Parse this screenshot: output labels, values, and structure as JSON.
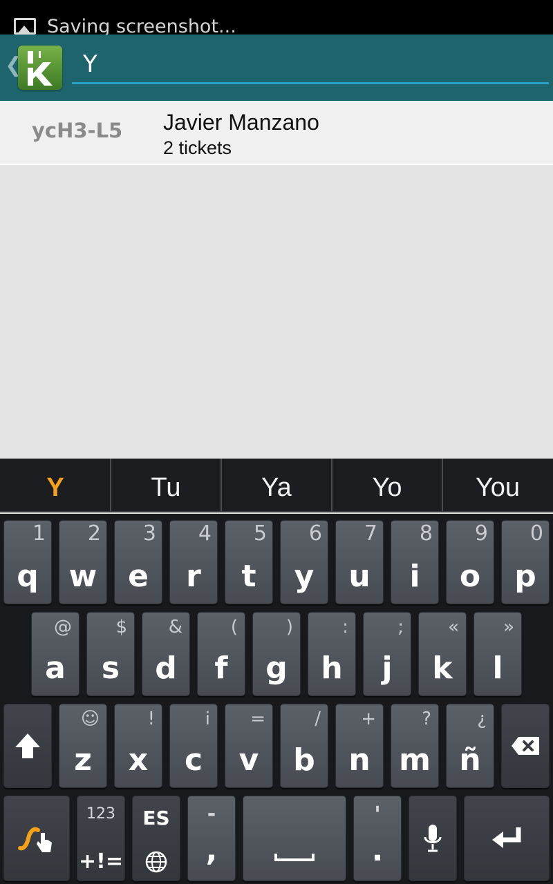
{
  "status_bar": {
    "notification_text": "Saving screenshot..."
  },
  "action_bar": {
    "search_value": "Y",
    "back_icon": "chevron-left-icon",
    "logo_icon": "k-app-logo"
  },
  "results": [
    {
      "code": "ycH3-L5",
      "name": "Javier Manzano",
      "detail": "2 tickets"
    }
  ],
  "suggestions": [
    "Y",
    "Tu",
    "Ya",
    "Yo",
    "You"
  ],
  "keyboard": {
    "row1": [
      {
        "main": "q",
        "sub": "1"
      },
      {
        "main": "w",
        "sub": "2"
      },
      {
        "main": "e",
        "sub": "3"
      },
      {
        "main": "r",
        "sub": "4"
      },
      {
        "main": "t",
        "sub": "5"
      },
      {
        "main": "y",
        "sub": "6"
      },
      {
        "main": "u",
        "sub": "7"
      },
      {
        "main": "i",
        "sub": "8"
      },
      {
        "main": "o",
        "sub": "9"
      },
      {
        "main": "p",
        "sub": "0"
      }
    ],
    "row2": [
      {
        "main": "a",
        "sub": "@"
      },
      {
        "main": "s",
        "sub": "$"
      },
      {
        "main": "d",
        "sub": "&"
      },
      {
        "main": "f",
        "sub": "("
      },
      {
        "main": "g",
        "sub": ")"
      },
      {
        "main": "h",
        "sub": ":"
      },
      {
        "main": "j",
        "sub": ";"
      },
      {
        "main": "k",
        "sub": "«"
      },
      {
        "main": "l",
        "sub": "»"
      }
    ],
    "row3": [
      {
        "main": "z",
        "sub": "☺"
      },
      {
        "main": "x",
        "sub": "!"
      },
      {
        "main": "c",
        "sub": "i"
      },
      {
        "main": "v",
        "sub": "="
      },
      {
        "main": "b",
        "sub": "/"
      },
      {
        "main": "n",
        "sub": "+"
      },
      {
        "main": "m",
        "sub": "?"
      },
      {
        "main": "ñ",
        "sub": "¿"
      }
    ],
    "symbols_key": {
      "top": "123",
      "bottom": "+!="
    },
    "lang_key": {
      "label": "ES"
    },
    "comma_key": {
      "top": "-",
      "main": ","
    },
    "period_key": {
      "top": "'",
      "main": "."
    },
    "colors": {
      "accent": "#f5a21b",
      "action_bar": "#1e646c",
      "search_underline": "#2aa3c8"
    }
  }
}
